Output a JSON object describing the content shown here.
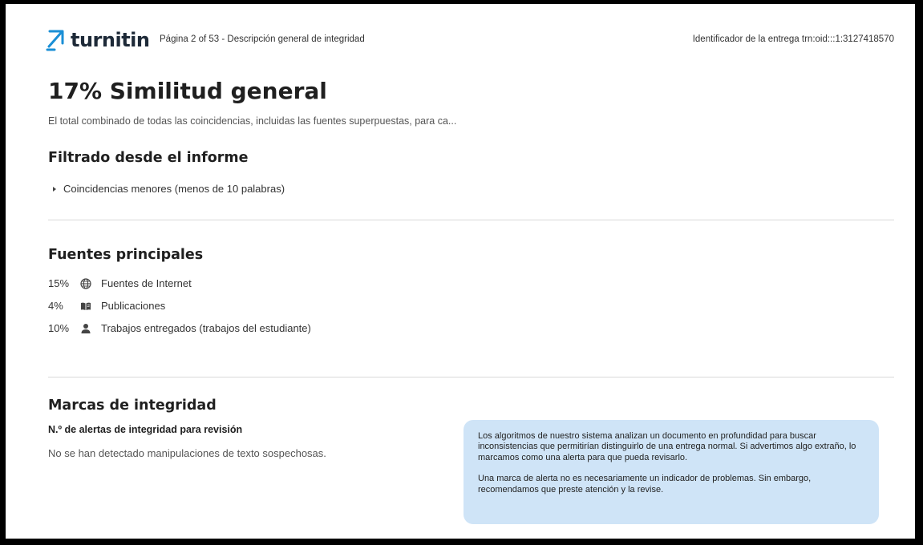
{
  "header": {
    "brand": "turnitin",
    "page_indicator": "Página 2 of 53 - Descripción general de integridad",
    "submission_id": "Identificador de la entrega trn:oid:::1:3127418570"
  },
  "summary": {
    "title": "17% Similitud general",
    "description": "El total combinado de todas las coincidencias, incluidas las fuentes superpuestas, para ca..."
  },
  "filtered": {
    "heading": "Filtrado desde el informe",
    "items": [
      "Coincidencias menores (menos de 10 palabras)"
    ]
  },
  "sources": {
    "heading": "Fuentes principales",
    "items": [
      {
        "percent": "15%",
        "icon": "globe-icon",
        "label": "Fuentes de Internet"
      },
      {
        "percent": "4%",
        "icon": "book-icon",
        "label": "Publicaciones"
      },
      {
        "percent": "10%",
        "icon": "person-icon",
        "label": "Trabajos entregados (trabajos del estudiante)"
      }
    ]
  },
  "integrity": {
    "heading": "Marcas de integridad",
    "alerts_label": "N.º de alertas de integridad para revisión",
    "status": "No se han detectado manipulaciones de texto sospechosas.",
    "info_paragraph_1": "Los algoritmos de nuestro sistema analizan un documento en profundidad para buscar inconsistencias que permitirían distinguirlo de una entrega normal. Si advertimos algo extraño, lo marcamos como una alerta para que pueda revisarlo.",
    "info_paragraph_2": "Una marca de alerta no es necesariamente un indicador de problemas. Sin embargo, recomendamos que preste atención y la revise."
  },
  "colors": {
    "brand_blue": "#1a8fd6",
    "brand_text": "#1e2a38",
    "info_box_bg": "#cfe4f7",
    "divider": "#d9d9d9"
  }
}
